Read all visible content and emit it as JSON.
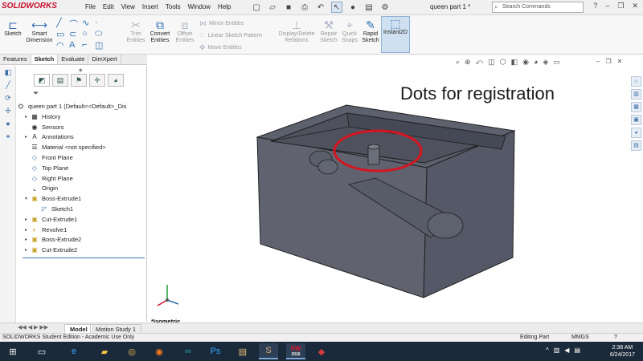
{
  "app": {
    "logo_text": "SOLIDWORKS",
    "window_title": "queen part 1 *",
    "menu": [
      "File",
      "Edit",
      "View",
      "Insert",
      "Tools",
      "Window",
      "Help"
    ],
    "search_placeholder": "Search Commands"
  },
  "ribbon": {
    "sketch": "Sketch",
    "smart_dimension": "Smart\nDimension",
    "trim_entities": "Trim\nEntities",
    "convert_entities": "Convert\nEntities",
    "offset_entities": "Offset\nEntities",
    "mirror_entities": "Mirror Entities",
    "linear_sketch_pattern": "Linear Sketch Pattern",
    "move_entities": "Move Entities",
    "display_delete_relations": "Display/Delete\nRelations",
    "repair_sketch": "Repair\nSketch",
    "quick_snaps": "Quick\nSnaps",
    "rapid_sketch": "Rapid\nSketch",
    "instant2d": "Instant2D"
  },
  "command_tabs": [
    "Features",
    "Sketch",
    "Evaluate",
    "DimXpert"
  ],
  "tree": {
    "root": "queen part 1  (Default<<Default>_Dis",
    "items": [
      {
        "label": "History",
        "expand": "▸"
      },
      {
        "label": "Sensors",
        "expand": ""
      },
      {
        "label": "Annotations",
        "expand": "▸"
      },
      {
        "label": "Material <not specified>",
        "expand": ""
      },
      {
        "label": "Front Plane",
        "expand": ""
      },
      {
        "label": "Top Plane",
        "expand": ""
      },
      {
        "label": "Right Plane",
        "expand": ""
      },
      {
        "label": "Origin",
        "expand": ""
      },
      {
        "label": "Boss-Extrude1",
        "expand": "▾"
      },
      {
        "label": "Sketch1",
        "expand": ""
      },
      {
        "label": "Cut-Extrude1",
        "expand": "▸"
      },
      {
        "label": "Revolve1",
        "expand": "▸"
      },
      {
        "label": "Boss-Extrude2",
        "expand": "▸"
      },
      {
        "label": "Cut-Extrude2",
        "expand": "▸"
      }
    ]
  },
  "viewport": {
    "annotation_text": "Dots for registration",
    "view_label": "*Isometric",
    "model_color": "#5a5d6b",
    "circle_color": "#d7141f"
  },
  "bottom_tabs": [
    "Model",
    "Motion Study 1"
  ],
  "status": {
    "left": "SOLIDWORKS Student Edition - Academic Use Only",
    "mode": "Editing Part",
    "units": "MMGS"
  },
  "taskbar": {
    "time": "2:38 AM",
    "date": "6/24/2017",
    "sw_badge": "2016"
  }
}
